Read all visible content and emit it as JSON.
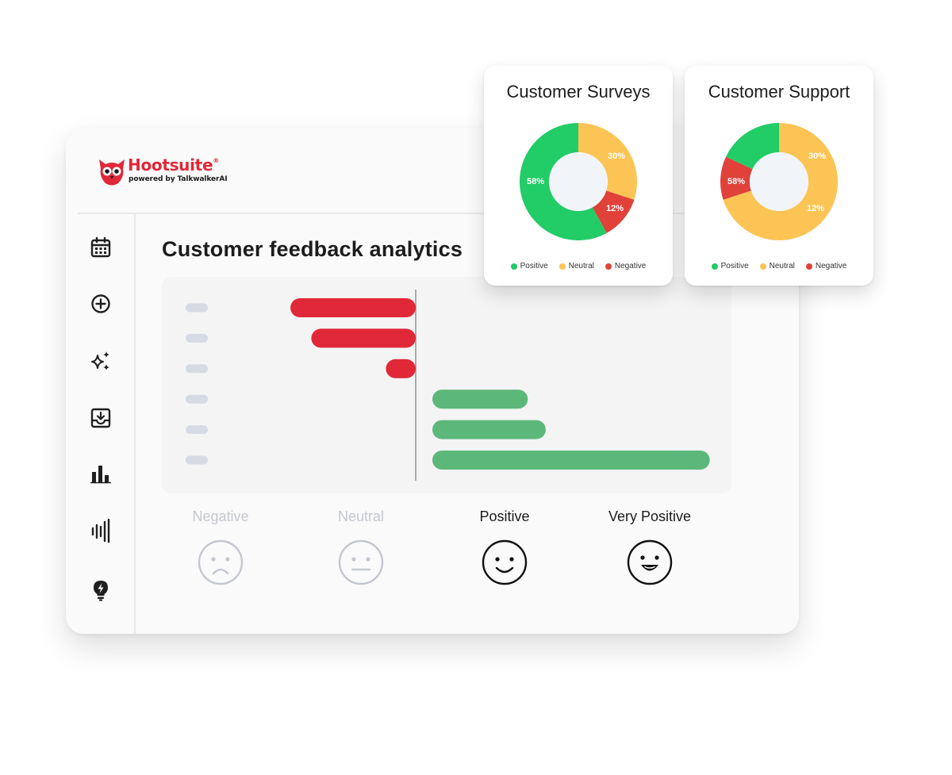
{
  "brand": {
    "name": "Hootsuite",
    "reg": "®",
    "tagline": "powered by TalkwalkerAI",
    "color": "#e02838"
  },
  "sidebar": {
    "items": [
      {
        "icon": "calendar-icon"
      },
      {
        "icon": "plus-circle-icon"
      },
      {
        "icon": "sparkles-icon"
      },
      {
        "icon": "inbox-download-icon"
      },
      {
        "icon": "bar-chart-icon"
      },
      {
        "icon": "listening-bars-icon"
      },
      {
        "icon": "lightbulb-icon"
      }
    ]
  },
  "main": {
    "title": "Customer feedback analytics"
  },
  "sentiments": [
    {
      "label": "Negative",
      "face": "sad-face-icon",
      "active": false
    },
    {
      "label": "Neutral",
      "face": "neutral-face-icon",
      "active": false
    },
    {
      "label": "Positive",
      "face": "smile-face-icon",
      "active": true
    },
    {
      "label": "Very Positive",
      "face": "grin-face-icon",
      "active": true
    }
  ],
  "chart_data": [
    {
      "type": "bar",
      "orientation": "horizontal-diverging",
      "title": "",
      "categories": [
        "",
        "",
        "",
        "",
        "",
        ""
      ],
      "series": [
        {
          "values": [
            -42,
            -35,
            -10,
            32,
            38,
            93
          ]
        }
      ],
      "colors": {
        "negative": "#e02838",
        "positive": "#5cb87a"
      },
      "xlim": [
        -42,
        100
      ]
    },
    {
      "type": "pie",
      "title": "Customer Surveys",
      "labels": [
        "Positive",
        "Neutral",
        "Negative"
      ],
      "values": [
        58,
        30,
        12
      ],
      "value_labels": [
        "58%",
        "30%",
        "12%"
      ],
      "colors": [
        "#22cc66",
        "#fcc454",
        "#e0423a"
      ],
      "legend": "bottom"
    },
    {
      "type": "pie",
      "title": "Customer Support",
      "labels": [
        "Positive",
        "Neutral",
        "Negative"
      ],
      "values": [
        18,
        70,
        12
      ],
      "value_labels": [
        "58%",
        "30%",
        "12%"
      ],
      "colors": [
        "#22cc66",
        "#fcc454",
        "#e0423a"
      ],
      "legend": "bottom"
    }
  ]
}
